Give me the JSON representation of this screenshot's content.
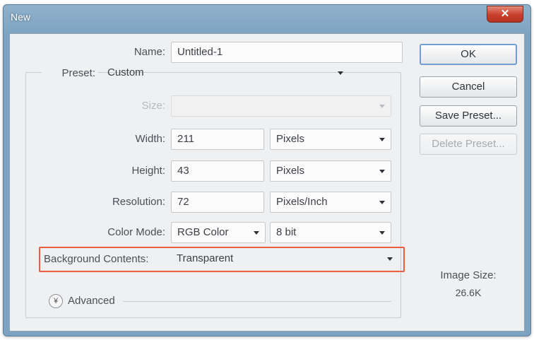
{
  "window": {
    "title": "New",
    "close_glyph": "✕"
  },
  "form": {
    "name": {
      "label": "Name:",
      "value": "Untitled-1"
    },
    "preset": {
      "label": "Preset:",
      "value": "Custom"
    },
    "size": {
      "label": "Size:",
      "value": ""
    },
    "width": {
      "label": "Width:",
      "value": "211",
      "unit": "Pixels"
    },
    "height": {
      "label": "Height:",
      "value": "43",
      "unit": "Pixels"
    },
    "resolution": {
      "label": "Resolution:",
      "value": "72",
      "unit": "Pixels/Inch"
    },
    "color_mode": {
      "label": "Color Mode:",
      "value": "RGB Color",
      "depth": "8 bit"
    },
    "background": {
      "label": "Background Contents:",
      "value": "Transparent"
    },
    "advanced": {
      "label": "Advanced",
      "icon": "double-chevron-down-icon",
      "glyph": "¥"
    }
  },
  "buttons": {
    "ok": "OK",
    "cancel": "Cancel",
    "save_preset": "Save Preset...",
    "delete_preset": "Delete Preset..."
  },
  "image_size": {
    "label": "Image Size:",
    "value": "26.6K"
  },
  "colors": {
    "highlight": "#e8603f",
    "titlebar": "#7ea3c2",
    "close": "#c7402b"
  }
}
